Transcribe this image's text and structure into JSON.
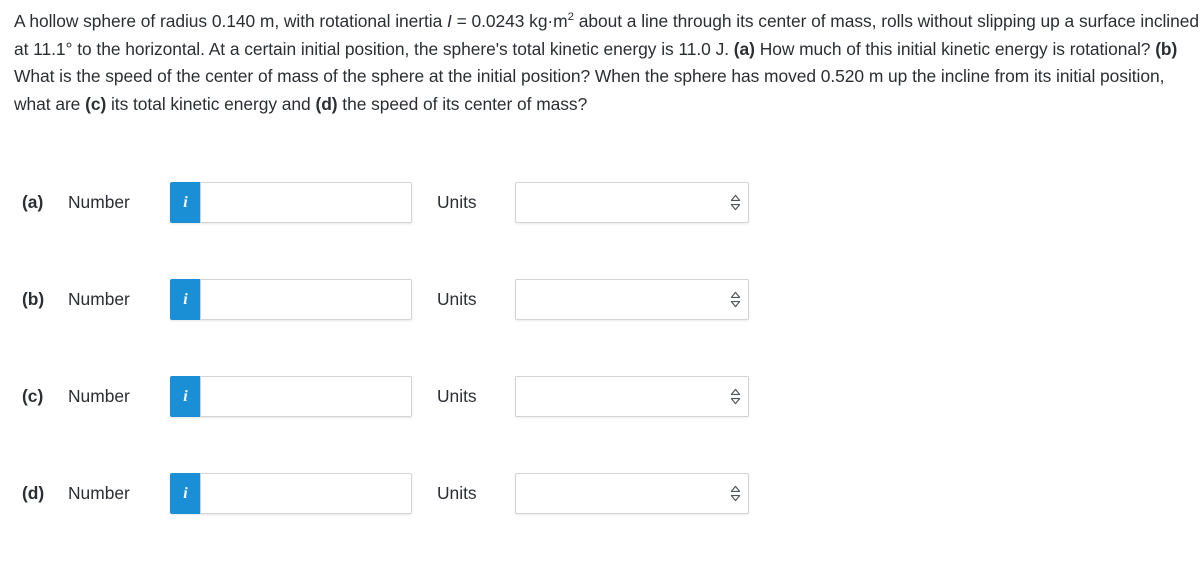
{
  "problem": {
    "segments": [
      {
        "type": "text",
        "value": "A hollow sphere of radius 0.140 m, with rotational inertia "
      },
      {
        "type": "italic",
        "value": "I"
      },
      {
        "type": "text",
        "value": " = 0.0243 kg·m"
      },
      {
        "type": "sup",
        "value": "2"
      },
      {
        "type": "text",
        "value": " about a line through its center of mass, rolls without slipping up a surface inclined at 11.1° to the horizontal. At a certain initial position, the sphere's total kinetic energy is 11.0 J. "
      },
      {
        "type": "bold",
        "value": "(a)"
      },
      {
        "type": "text",
        "value": " How much of this initial kinetic energy is rotational? "
      },
      {
        "type": "bold",
        "value": "(b)"
      },
      {
        "type": "text",
        "value": " What is the speed of the center of mass of the sphere at the initial position? When the sphere has moved 0.520 m up the incline from its initial position, what are "
      },
      {
        "type": "bold",
        "value": "(c)"
      },
      {
        "type": "text",
        "value": " its total kinetic energy and "
      },
      {
        "type": "bold",
        "value": "(d)"
      },
      {
        "type": "text",
        "value": " the speed of its center of mass?"
      }
    ],
    "plain_text": "A hollow sphere of radius 0.140 m, with rotational inertia I = 0.0243 kg·m2 about a line through its center of mass, rolls without slipping up a surface inclined at 11.1° to the horizontal. At a certain initial position, the sphere's total kinetic energy is 11.0 J. (a) How much of this initial kinetic energy is rotational? (b) What is the speed of the center of mass of the sphere at the initial position? When the sphere has moved 0.520 m up the incline from its initial position, what are (c) its total kinetic energy and (d) the speed of its center of mass?",
    "given_values": {
      "radius_m": "0.140",
      "rotational_inertia_kg_m2": "0.0243",
      "incline_angle_deg": "11.1",
      "initial_total_kinetic_energy_J": "11.0",
      "distance_moved_up_incline_m": "0.520"
    }
  },
  "answer_rows": [
    {
      "part": "(a)",
      "number_label": "Number",
      "info_icon": "info-icon",
      "info_icon_glyph": "i",
      "number_value": "",
      "number_placeholder": "",
      "units_label": "Units",
      "units_value": "",
      "units_chevron_icon": "chevron-up-down-icon"
    },
    {
      "part": "(b)",
      "number_label": "Number",
      "info_icon": "info-icon",
      "info_icon_glyph": "i",
      "number_value": "",
      "number_placeholder": "",
      "units_label": "Units",
      "units_value": "",
      "units_chevron_icon": "chevron-up-down-icon"
    },
    {
      "part": "(c)",
      "number_label": "Number",
      "info_icon": "info-icon",
      "info_icon_glyph": "i",
      "number_value": "",
      "number_placeholder": "",
      "units_label": "Units",
      "units_value": "",
      "units_chevron_icon": "chevron-up-down-icon"
    },
    {
      "part": "(d)",
      "number_label": "Number",
      "info_icon": "info-icon",
      "info_icon_glyph": "i",
      "number_value": "",
      "number_placeholder": "",
      "units_label": "Units",
      "units_value": "",
      "units_chevron_icon": "chevron-up-down-icon"
    }
  ],
  "colors": {
    "info_button_blue": "#1b8fd6",
    "text": "#2b2f33",
    "field_border": "#d4d4d4",
    "page_background": "#ffffff"
  }
}
